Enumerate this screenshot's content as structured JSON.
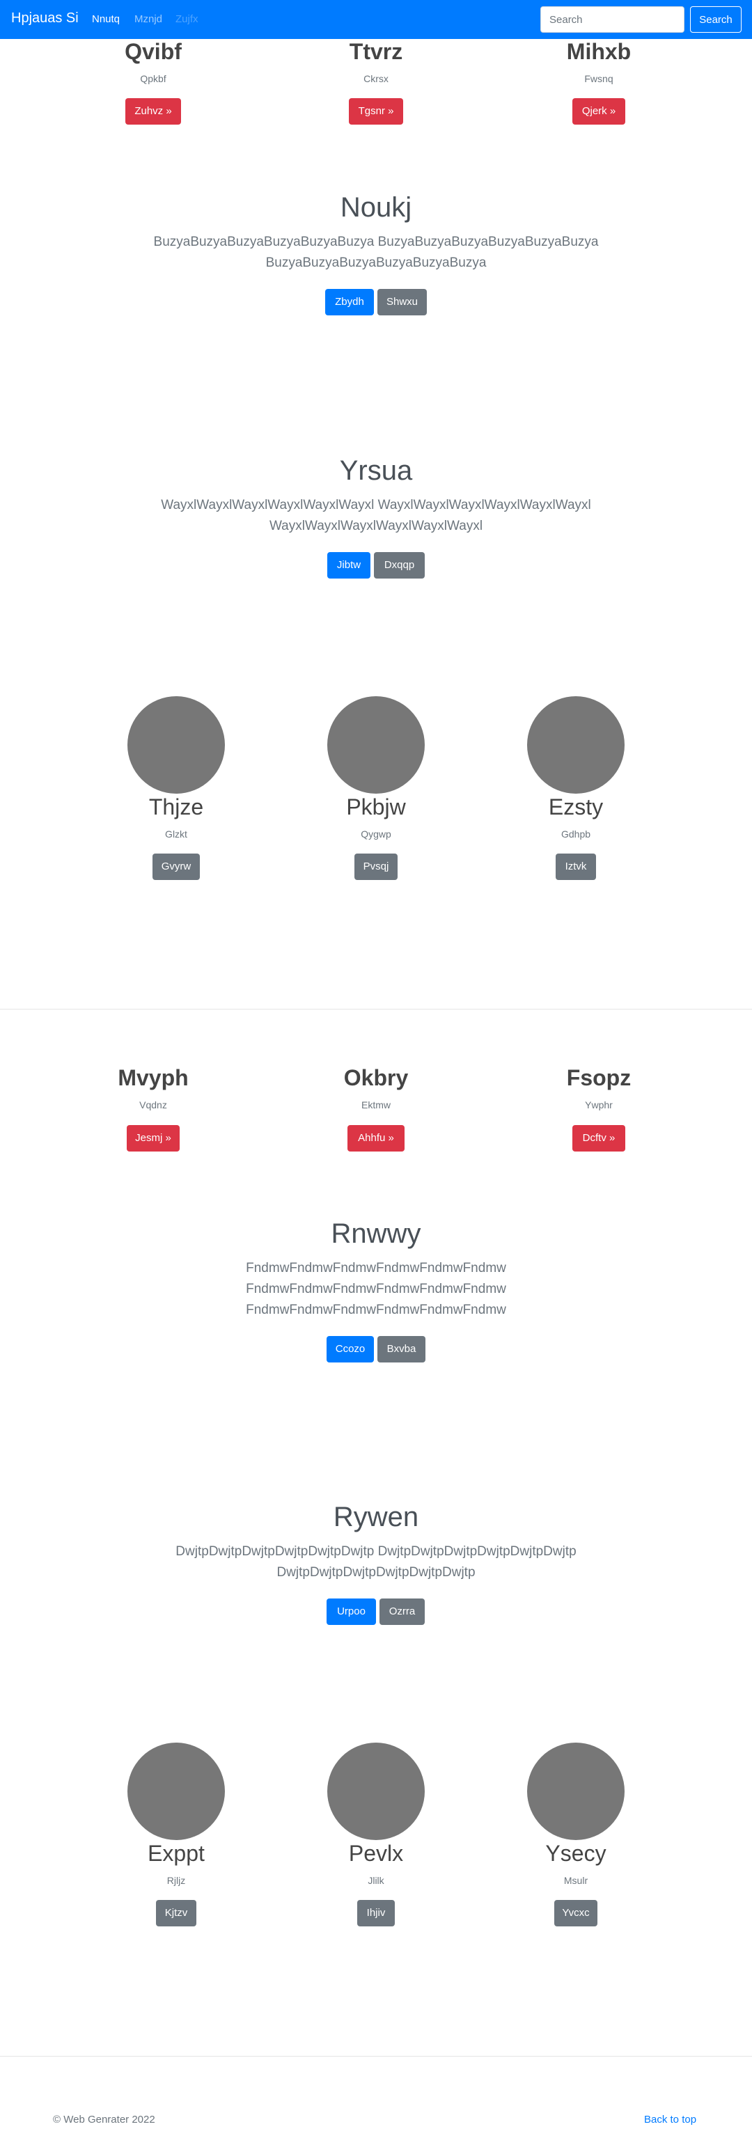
{
  "navbar": {
    "brand": "Hpjauas Si",
    "links": [
      {
        "label": "Nnutq",
        "state": "active"
      },
      {
        "label": "Mznjd",
        "state": "normal"
      },
      {
        "label": "Zujfx",
        "state": "disabled"
      }
    ],
    "search": {
      "placeholder": "Search",
      "button": "Search"
    }
  },
  "features1": [
    {
      "title": "Qvibf",
      "subtitle": "Qpkbf",
      "button": "Zuhvz »"
    },
    {
      "title": "Ttvrz",
      "subtitle": "Ckrsx",
      "button": "Tgsnr »"
    },
    {
      "title": "Mihxb",
      "subtitle": "Fwsnq",
      "button": "Qjerk »"
    }
  ],
  "hero1": {
    "title": "Noukj",
    "lines": [
      "BuzyaBuzyaBuzyaBuzyaBuzyaBuzya BuzyaBuzyaBuzyaBuzyaBuzyaBuzya",
      "BuzyaBuzyaBuzyaBuzyaBuzyaBuzya"
    ],
    "primary": "Zbydh",
    "secondary": "Shwxu"
  },
  "hero2": {
    "title": "Yrsua",
    "lines": [
      "WayxlWayxlWayxlWayxlWayxlWayxl WayxlWayxlWayxlWayxlWayxlWayxl",
      "WayxlWayxlWayxlWayxlWayxlWayxl"
    ],
    "primary": "Jibtw",
    "secondary": "Dxqqp"
  },
  "circles1": [
    {
      "title": "Thjze",
      "subtitle": "Glzkt",
      "button": "Gvyrw"
    },
    {
      "title": "Pkbjw",
      "subtitle": "Qygwp",
      "button": "Pvsqj"
    },
    {
      "title": "Ezsty",
      "subtitle": "Gdhpb",
      "button": "Iztvk"
    }
  ],
  "features2": [
    {
      "title": "Mvyph",
      "subtitle": "Vqdnz",
      "button": "Jesmj »"
    },
    {
      "title": "Okbry",
      "subtitle": "Ektmw",
      "button": "Ahhfu »"
    },
    {
      "title": "Fsopz",
      "subtitle": "Ywphr",
      "button": "Dcftv »"
    }
  ],
  "hero3": {
    "title": "Rnwwy",
    "lines": [
      "FndmwFndmwFndmwFndmwFndmwFndmw",
      "FndmwFndmwFndmwFndmwFndmwFndmw",
      "FndmwFndmwFndmwFndmwFndmwFndmw"
    ],
    "primary": "Ccozo",
    "secondary": "Bxvba"
  },
  "hero4": {
    "title": "Rywen",
    "lines": [
      "DwjtpDwjtpDwjtpDwjtpDwjtpDwjtp DwjtpDwjtpDwjtpDwjtpDwjtpDwjtp",
      "DwjtpDwjtpDwjtpDwjtpDwjtpDwjtp"
    ],
    "primary": "Urpoo",
    "secondary": "Ozrra"
  },
  "circles2": [
    {
      "title": "Exppt",
      "subtitle": "Rjljz",
      "button": "Kjtzv"
    },
    {
      "title": "Pevlx",
      "subtitle": "Jlilk",
      "button": "Ihjiv"
    },
    {
      "title": "Ysecy",
      "subtitle": "Msulr",
      "button": "Yvcxc"
    }
  ],
  "footer": {
    "copyright": "© Web Genrater 2022",
    "back_to_top": "Back to top"
  }
}
